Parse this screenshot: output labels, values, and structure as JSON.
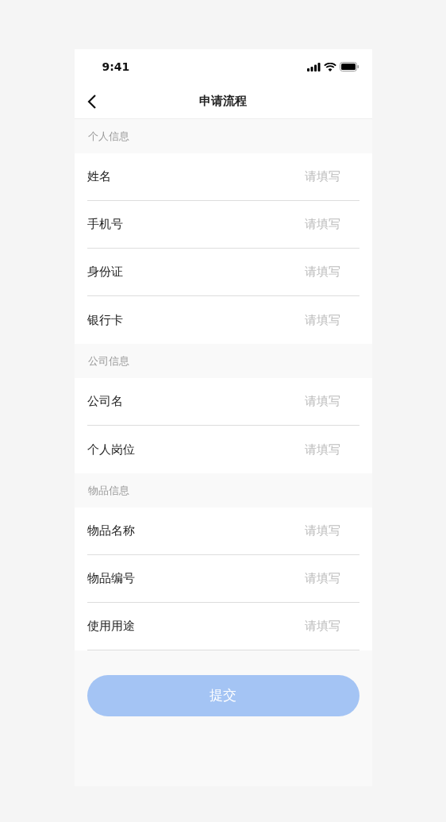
{
  "status_bar": {
    "time": "9:41"
  },
  "nav": {
    "title": "申请流程"
  },
  "sections": [
    {
      "title": "个人信息",
      "fields": [
        {
          "label": "姓名",
          "placeholder": "请填写"
        },
        {
          "label": "手机号",
          "placeholder": "请填写"
        },
        {
          "label": "身份证",
          "placeholder": "请填写"
        },
        {
          "label": "银行卡",
          "placeholder": "请填写"
        }
      ]
    },
    {
      "title": "公司信息",
      "fields": [
        {
          "label": "公司名",
          "placeholder": "请填写"
        },
        {
          "label": "个人岗位",
          "placeholder": "请填写"
        }
      ]
    },
    {
      "title": "物品信息",
      "fields": [
        {
          "label": "物品名称",
          "placeholder": "请填写"
        },
        {
          "label": "物品编号",
          "placeholder": "请填写"
        },
        {
          "label": "使用用途",
          "placeholder": "请填写"
        }
      ]
    }
  ],
  "submit": {
    "label": "提交",
    "disabled": true
  }
}
